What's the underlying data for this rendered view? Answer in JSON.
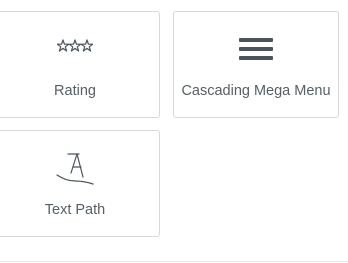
{
  "widgets": [
    {
      "label": "Rating",
      "icon": "rating-stars-icon"
    },
    {
      "label": "Cascading Mega Menu",
      "icon": "hamburger-menu-icon"
    },
    {
      "label": "Text Path",
      "icon": "text-path-icon"
    }
  ],
  "colors": {
    "card_border": "#d5d8dc",
    "label_text": "#556068",
    "icon": "#4a545d"
  }
}
